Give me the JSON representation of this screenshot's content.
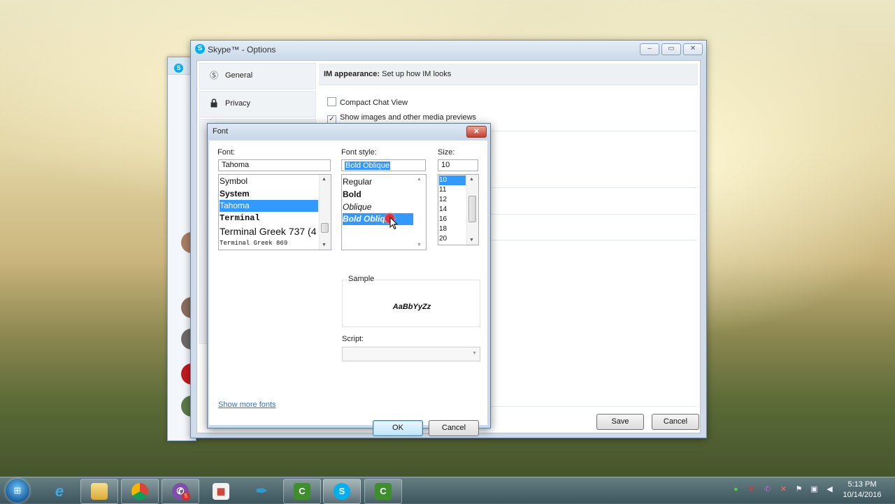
{
  "options_window": {
    "title": "Skype™ - Options",
    "nav_items": [
      {
        "label": "General",
        "icon": "skype-icon"
      },
      {
        "label": "Privacy",
        "icon": "lock-icon"
      }
    ],
    "im_appearance_heading": "IM appearance:",
    "im_appearance_desc": "Set up how IM looks",
    "options": [
      {
        "label": "Compact Chat View",
        "checked": false
      },
      {
        "label": "Show images and other media previews",
        "checked": true
      }
    ],
    "save_label": "Save",
    "cancel_label": "Cancel"
  },
  "font_dialog": {
    "title": "Font",
    "font_label": "Font:",
    "font_value": "Tahoma",
    "font_list": [
      "Symbol",
      "System",
      "Tahoma",
      "Terminal",
      "Terminal Greek 737 (4",
      "Terminal Greek 869"
    ],
    "font_selected": "Tahoma",
    "style_label": "Font style:",
    "style_value": "Bold Oblique",
    "style_list": [
      "Regular",
      "Bold",
      "Oblique",
      "Bold Oblique"
    ],
    "style_selected": "Bold Oblique",
    "size_label": "Size:",
    "size_value": "10",
    "size_list": [
      "10",
      "11",
      "12",
      "14",
      "16",
      "18",
      "20"
    ],
    "size_selected": "10",
    "sample_label": "Sample",
    "sample_text": "AaBbYyZz",
    "script_label": "Script:",
    "script_value": "",
    "show_more_fonts": "Show more fonts",
    "ok_label": "OK",
    "cancel_label": "Cancel"
  },
  "taskbar": {
    "apps": [
      "internet-explorer-icon",
      "file-explorer-icon",
      "chrome-icon",
      "viber-icon",
      "office-icon",
      "feather-app-icon",
      "camtasia-icon",
      "skype-icon",
      "camtasia-recorder-icon"
    ],
    "viber_badge": "5",
    "clock_time": "5:13 PM",
    "clock_date": "10/14/2016"
  },
  "colors": {
    "selection": "#3399ff",
    "link": "#3b6fb6",
    "skype_blue": "#00aff0"
  }
}
